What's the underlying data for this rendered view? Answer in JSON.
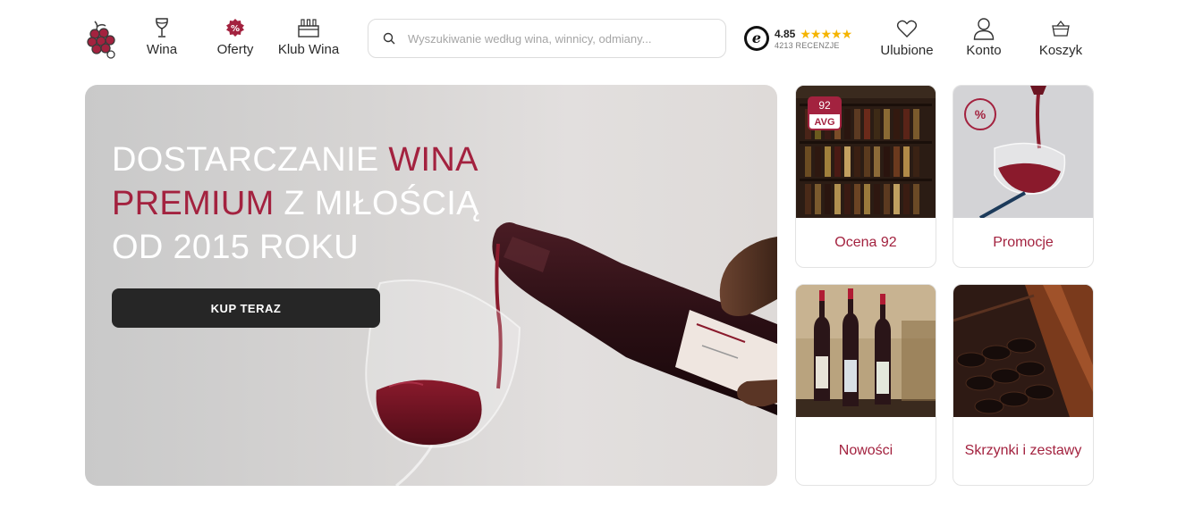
{
  "header": {
    "nav": [
      {
        "label": "Wina",
        "icon": "wine-glass-icon"
      },
      {
        "label": "Oferty",
        "icon": "percent-badge-icon"
      },
      {
        "label": "Klub Wina",
        "icon": "wine-case-icon"
      }
    ],
    "search": {
      "placeholder": "Wyszukiwanie według wina, winnicy, odmiany...",
      "value": ""
    },
    "rating": {
      "score": "4.85",
      "stars": "★★★★★",
      "reviews": "4213 RECENZJE",
      "badge_letter": "e"
    },
    "utility": [
      {
        "label": "Ulubione",
        "icon": "heart-icon"
      },
      {
        "label": "Konto",
        "icon": "user-icon"
      },
      {
        "label": "Koszyk",
        "icon": "basket-icon"
      }
    ]
  },
  "hero": {
    "title_part1": "DOSTARCZANIE ",
    "title_accent1": "WINA",
    "title_accent2": "PREMIUM",
    "title_part2": " Z MIŁOŚCIĄ",
    "title_part3": "OD 2015 ROKU",
    "cta": "KUP TERAZ"
  },
  "tiles": [
    {
      "label": "Ocena 92",
      "badge_score": "92",
      "badge_text": "AVG"
    },
    {
      "label": "Promocje",
      "badge_text": "%"
    },
    {
      "label": "Nowości"
    },
    {
      "label": "Skrzynki i zestawy"
    }
  ],
  "colors": {
    "accent": "#a3223f",
    "dark_button": "#262626",
    "star": "#f5b400"
  }
}
